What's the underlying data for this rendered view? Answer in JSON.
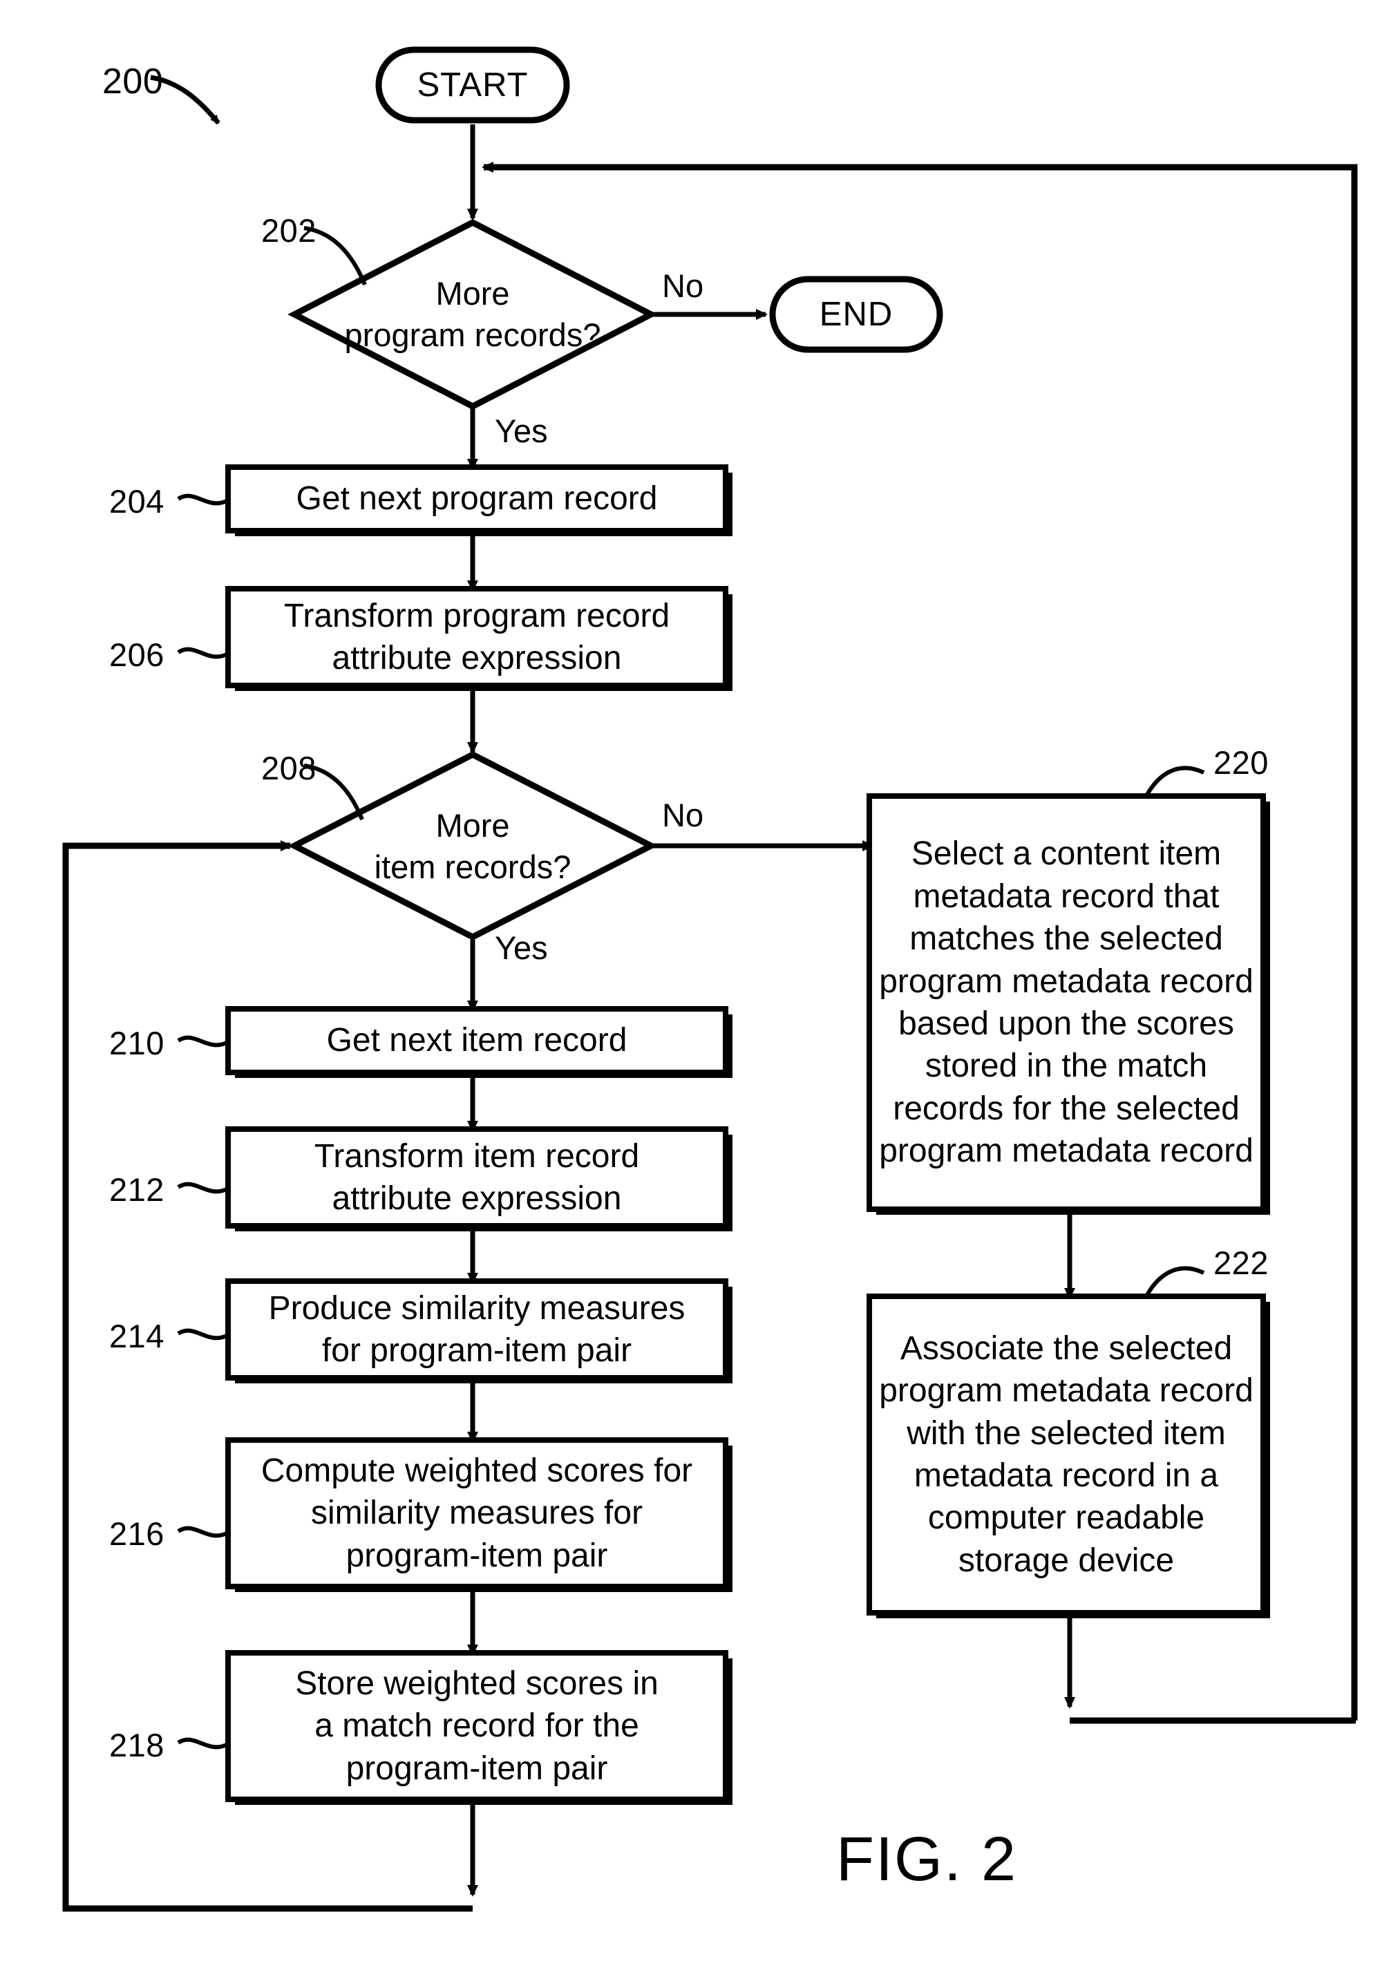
{
  "figure": {
    "caption": "FIG. 2",
    "diagram_ref": "200"
  },
  "nodes": {
    "start": {
      "ref": "",
      "label": "START",
      "shape": "terminal"
    },
    "end": {
      "ref": "",
      "label": "END",
      "shape": "terminal"
    },
    "d202": {
      "ref": "202",
      "label": "More\nprogram records?",
      "shape": "decision"
    },
    "b204": {
      "ref": "204",
      "label": "Get next program record",
      "shape": "process"
    },
    "b206": {
      "ref": "206",
      "label": "Transform program record\nattribute expression",
      "shape": "process"
    },
    "d208": {
      "ref": "208",
      "label": "More\nitem records?",
      "shape": "decision"
    },
    "b210": {
      "ref": "210",
      "label": "Get next item record",
      "shape": "process"
    },
    "b212": {
      "ref": "212",
      "label": "Transform item record\nattribute expression",
      "shape": "process"
    },
    "b214": {
      "ref": "214",
      "label": "Produce similarity measures\nfor program-item pair",
      "shape": "process"
    },
    "b216": {
      "ref": "216",
      "label": "Compute weighted scores for\nsimilarity measures for\nprogram-item pair",
      "shape": "process"
    },
    "b218": {
      "ref": "218",
      "label": "Store weighted scores in\na match record for the\nprogram-item pair",
      "shape": "process"
    },
    "b220": {
      "ref": "220",
      "label": "Select a content item\nmetadata record that\nmatches the selected\nprogram metadata record\nbased upon the scores\nstored in the match\nrecords for the selected\nprogram metadata record",
      "shape": "process"
    },
    "b222": {
      "ref": "222",
      "label": "Associate the selected\nprogram metadata record\nwith the selected item\nmetadata record in a\ncomputer readable\nstorage device",
      "shape": "process"
    }
  },
  "edge_labels": {
    "d202_no": "No",
    "d202_yes": "Yes",
    "d208_no": "No",
    "d208_yes": "Yes"
  },
  "style": {
    "stroke": "#000000",
    "fill": "#ffffff",
    "background": "#ffffff"
  }
}
